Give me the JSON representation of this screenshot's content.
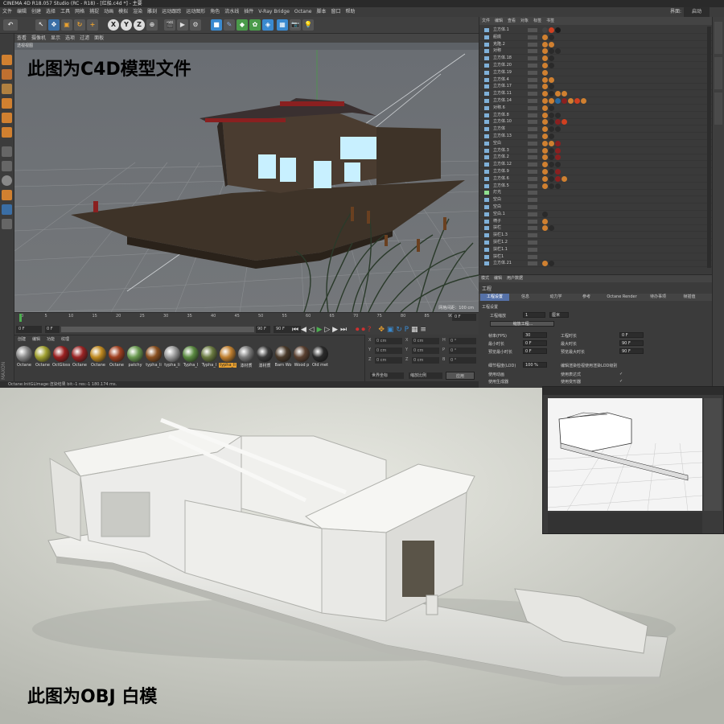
{
  "window": {
    "title": "CINEMA 4D R18.057 Studio (RC - R18) - [红船.c4d *] - 主要",
    "menu_items": [
      "文件",
      "编辑",
      "创建",
      "选择",
      "工具",
      "网格",
      "捕捉",
      "动画",
      "模拟",
      "渲染",
      "雕刻",
      "运动跟踪",
      "运动图形",
      "角色",
      "流水线",
      "插件",
      "V-Ray Bridge",
      "Octane",
      "脚本",
      "窗口",
      "帮助"
    ],
    "layout_label": "界面:",
    "layout_value": "启动"
  },
  "viewport": {
    "menu": [
      "查看",
      "摄像机",
      "显示",
      "选项",
      "过滤",
      "面板"
    ],
    "title": "透视视图",
    "grid_info": "网格间距：100 cm",
    "overlay_label": "此图为C4D模型文件"
  },
  "timeline": {
    "ticks": [
      "0",
      "5",
      "10",
      "15",
      "20",
      "25",
      "30",
      "35",
      "40",
      "45",
      "50",
      "55",
      "60",
      "65",
      "70",
      "75",
      "80",
      "85",
      "90"
    ],
    "current_frame": "0 F",
    "start_frame": "0 F",
    "end_frame": "90 F",
    "end_frame2": "90 F",
    "frame_end_label": "0 F"
  },
  "materials": {
    "menu": [
      "创建",
      "编辑",
      "功能",
      "纹理"
    ],
    "items": [
      {
        "label": "Octane",
        "color": "#8a8a8a"
      },
      {
        "label": "Octane",
        "color": "#a0a030"
      },
      {
        "label": "OctGloss",
        "color": "#9a2020"
      },
      {
        "label": "Octane",
        "color": "#9a2424"
      },
      {
        "label": "Octane",
        "color": "#c08a20"
      },
      {
        "label": "Octane",
        "color": "#a04020"
      },
      {
        "label": "patchy",
        "color": "#6a9a50"
      },
      {
        "label": "typha_li",
        "color": "#8a5020"
      },
      {
        "label": "typha_li",
        "color": "#9a9a9a"
      },
      {
        "label": "Typha_l",
        "color": "#5a8a40"
      },
      {
        "label": "Typha_l",
        "color": "#6a7a40"
      },
      {
        "label": "typha_li",
        "color": "#c08030"
      },
      {
        "label": "漆材质",
        "color": "#7a7a7a"
      },
      {
        "label": "漆材质",
        "color": "#3a3a3a"
      },
      {
        "label": "Barn Wo",
        "color": "#4a3a2a"
      },
      {
        "label": "Wood p",
        "color": "#5a4030"
      },
      {
        "label": "Old met",
        "color": "#2a2a2a"
      }
    ]
  },
  "coords": {
    "rows": [
      {
        "axis": "X",
        "v1": "0 cm",
        "axis2": "X",
        "v2": "0 cm",
        "axis3": "H",
        "v3": "0 °"
      },
      {
        "axis": "Y",
        "v1": "0 cm",
        "axis2": "Y",
        "v2": "0 cm",
        "axis3": "P",
        "v3": "0 °"
      },
      {
        "axis": "Z",
        "v1": "0 cm",
        "axis2": "Z",
        "v2": "0 cm",
        "axis3": "B",
        "v3": "0 °"
      }
    ],
    "dropdown1": "世界坐标",
    "dropdown2": "缩放比例",
    "apply": "应用"
  },
  "status": "Octane:InitGLImage:渲染结果 bit:-1 res:-1 180.174 ms.",
  "object_manager": {
    "menu": [
      "文件",
      "编辑",
      "查看",
      "对象",
      "标签",
      "书签"
    ],
    "rows": [
      {
        "name": "立方体.1",
        "tags": [
          "#444",
          "#d04020",
          "#1a1a1a"
        ]
      },
      {
        "name": "船底",
        "tags": [
          "#d08030",
          "#2a2a2a"
        ]
      },
      {
        "name": "克隆.2",
        "tags": [
          "#d08030",
          "#d08030"
        ]
      },
      {
        "name": "对称",
        "tags": [
          "#d08030",
          "#2a2a2a",
          "#2a2a2a"
        ]
      },
      {
        "name": "立方体.18",
        "tags": [
          "#d08030",
          "#2a2a2a"
        ]
      },
      {
        "name": "立方体.20",
        "tags": [
          "#d08030",
          "#2a2a2a"
        ]
      },
      {
        "name": "立方体.19",
        "tags": [
          "#d08030"
        ]
      },
      {
        "name": "立方体.4",
        "tags": [
          "#d08030",
          "#d08030"
        ]
      },
      {
        "name": "立方体.17",
        "tags": [
          "#d08030",
          "#2a2a2a"
        ]
      },
      {
        "name": "立方体.11",
        "tags": [
          "#d08030",
          "#2a2a2a",
          "#d08030",
          "#d08030"
        ]
      },
      {
        "name": "立方体.14",
        "tags": [
          "#d08030",
          "#d08030",
          "#2a6aa0",
          "#8a2020",
          "#d08030",
          "#d04020",
          "#d08030"
        ]
      },
      {
        "name": "对称.6",
        "tags": [
          "#d08030",
          "#2a2a2a"
        ]
      },
      {
        "name": "立方体.8",
        "tags": [
          "#d08030",
          "#2a2a2a",
          "#2a2a2a"
        ]
      },
      {
        "name": "立方体.10",
        "tags": [
          "#d08030",
          "#2a2a2a",
          "#8a2020",
          "#d04020"
        ]
      },
      {
        "name": "立方体",
        "tags": [
          "#d08030",
          "#2a2a2a",
          "#2a2a2a"
        ]
      },
      {
        "name": "立方体.13",
        "tags": [
          "#d08030",
          "#2a2a2a"
        ]
      },
      {
        "name": "空白",
        "tags": [
          "#d08030",
          "#d08030",
          "#8a2020"
        ]
      },
      {
        "name": "立方体.3",
        "tags": [
          "#d08030",
          "#2a2a2a",
          "#8a2020"
        ]
      },
      {
        "name": "立方体.2",
        "tags": [
          "#d08030",
          "#2a2a2a",
          "#8a2020"
        ]
      },
      {
        "name": "立方体.12",
        "tags": [
          "#d08030",
          "#2a2a2a",
          "#2a2a2a"
        ]
      },
      {
        "name": "立方体.9",
        "tags": [
          "#d08030",
          "#2a2a2a",
          "#8a2020"
        ]
      },
      {
        "name": "立方体.6",
        "tags": [
          "#d08030",
          "#2a2a2a",
          "#8a2020",
          "#d08030"
        ]
      },
      {
        "name": "立方体.5",
        "tags": [
          "#d08030",
          "#2a2a2a",
          "#2a2a2a"
        ]
      },
      {
        "name": "灯光",
        "tags": []
      },
      {
        "name": "空白",
        "tags": []
      },
      {
        "name": "空白",
        "tags": []
      },
      {
        "name": "空白.1",
        "tags": [
          "#2a2a2a"
        ]
      },
      {
        "name": "椅子",
        "tags": [
          "#d08030"
        ]
      },
      {
        "name": "扶栏",
        "tags": [
          "#d08030",
          "#2a2a2a"
        ]
      },
      {
        "name": "扶栏1.3",
        "tags": []
      },
      {
        "name": "扶栏1.2",
        "tags": []
      },
      {
        "name": "扶栏1.1",
        "tags": []
      },
      {
        "name": "扶栏1",
        "tags": []
      },
      {
        "name": "立方体.21",
        "tags": [
          "#d08030",
          "#2a2a2a"
        ]
      }
    ]
  },
  "attributes": {
    "menu": [
      "模式",
      "编辑",
      "用户数据"
    ],
    "title": "工程",
    "tabs": [
      "工程设置",
      "信息",
      "动力学",
      "参考",
      "Octane Render",
      "待办事项",
      "帧插值"
    ],
    "section": "工程设置",
    "scale_label": "工程缩放",
    "scale_value": "1",
    "scale_unit": "厘米",
    "scale_button": "缩放工程...",
    "fields": [
      {
        "label": "帧率(FPS)",
        "value": "30",
        "label2": "工程时长",
        "value2": "0 F"
      },
      {
        "label": "最小时长",
        "value": "0 F",
        "label2": "最大时长",
        "value2": "90 F"
      },
      {
        "label": "预览最小时长",
        "value": "0 F",
        "label2": "预览最大时长",
        "value2": "90 F"
      }
    ],
    "lod_label": "细节程度(LOD)",
    "lod_value": "100 %",
    "lod_render_label": "编辑渲染检视使用渲染LOD级别",
    "checks": [
      {
        "label": "使用动画",
        "label2": "使用表达式"
      },
      {
        "label": "使用生成器",
        "label2": "使用变形器"
      }
    ]
  },
  "render": {
    "overlay_label": "此图为OBJ 白模"
  }
}
